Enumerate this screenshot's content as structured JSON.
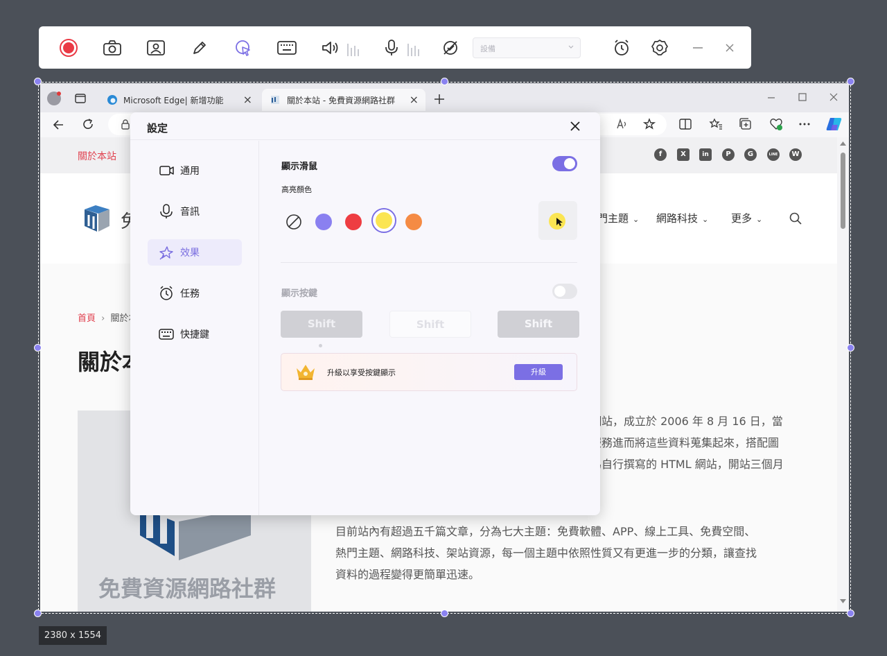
{
  "toolbar": {
    "device_placeholder": "設備",
    "icons": [
      "record-icon",
      "screenshot-icon",
      "webcam-icon",
      "pen-icon",
      "cursor-highlight-icon",
      "keyboard-icon",
      "speaker-icon",
      "microphone-icon",
      "no-watermark-icon",
      "alarm-icon",
      "settings-icon",
      "minimize-icon",
      "close-icon"
    ]
  },
  "capture": {
    "size_label": "2380 x 1554"
  },
  "browser": {
    "tabs": [
      {
        "label": "Microsoft Edge| 新增功能"
      },
      {
        "label": "關於本站 - 免費資源網路社群"
      }
    ],
    "site": {
      "topbar_link": "關於本站",
      "nav": [
        "門主題",
        "網路科技",
        "更多"
      ],
      "breadcrumb_home": "首頁",
      "breadcrumb_current": "關於本",
      "page_title": "關於本",
      "logo_text": "免",
      "image_caption": "免費資源網路社群",
      "paragraph1": [
        "網站，成立於 2006 年 8 月 16 日，當",
        "服務進而將這些資料蒐集起來，搭配圖",
        "為自行撰寫的 HTML 網站，開站三個月"
      ],
      "paragraph2": [
        "目前站內有超過五千篇文章，分為七大主題：免費軟體、APP、線上工具、免費空間、",
        "熱門主題、網路科技、架站資源，每一個主題中依照性質又有更進一步的分類，讓查找",
        "資料的過程變得更簡單迅速。"
      ],
      "social": [
        "f",
        "X",
        "in",
        "P",
        "G",
        "LINE",
        "W"
      ]
    }
  },
  "settings": {
    "title": "設定",
    "sidebar": [
      {
        "label": "通用",
        "icon": "camera-icon"
      },
      {
        "label": "音訊",
        "icon": "microphone-icon"
      },
      {
        "label": "效果",
        "icon": "sparkle-icon",
        "active": true
      },
      {
        "label": "任務",
        "icon": "alarm-icon"
      },
      {
        "label": "快捷鍵",
        "icon": "keyboard-icon"
      }
    ],
    "show_mouse": {
      "label": "顯示滑鼠",
      "enabled": true
    },
    "highlight_color": {
      "label": "高亮顏色",
      "options": [
        {
          "name": "none",
          "color": "transparent"
        },
        {
          "name": "purple",
          "color": "#8a80f0"
        },
        {
          "name": "red",
          "color": "#ee3d42"
        },
        {
          "name": "yellow",
          "color": "#fbe552",
          "selected": true
        },
        {
          "name": "orange",
          "color": "#f58b44"
        }
      ]
    },
    "show_keys": {
      "label": "顯示按鍵",
      "enabled": false,
      "key_samples": [
        "Shift",
        "Shift",
        "Shift"
      ]
    },
    "upgrade": {
      "text": "升級以享受按鍵顯示",
      "button": "升級"
    }
  },
  "colors": {
    "accent": "#7b6fe4",
    "record": "#ea3a45",
    "brand_red": "#e0404e"
  }
}
